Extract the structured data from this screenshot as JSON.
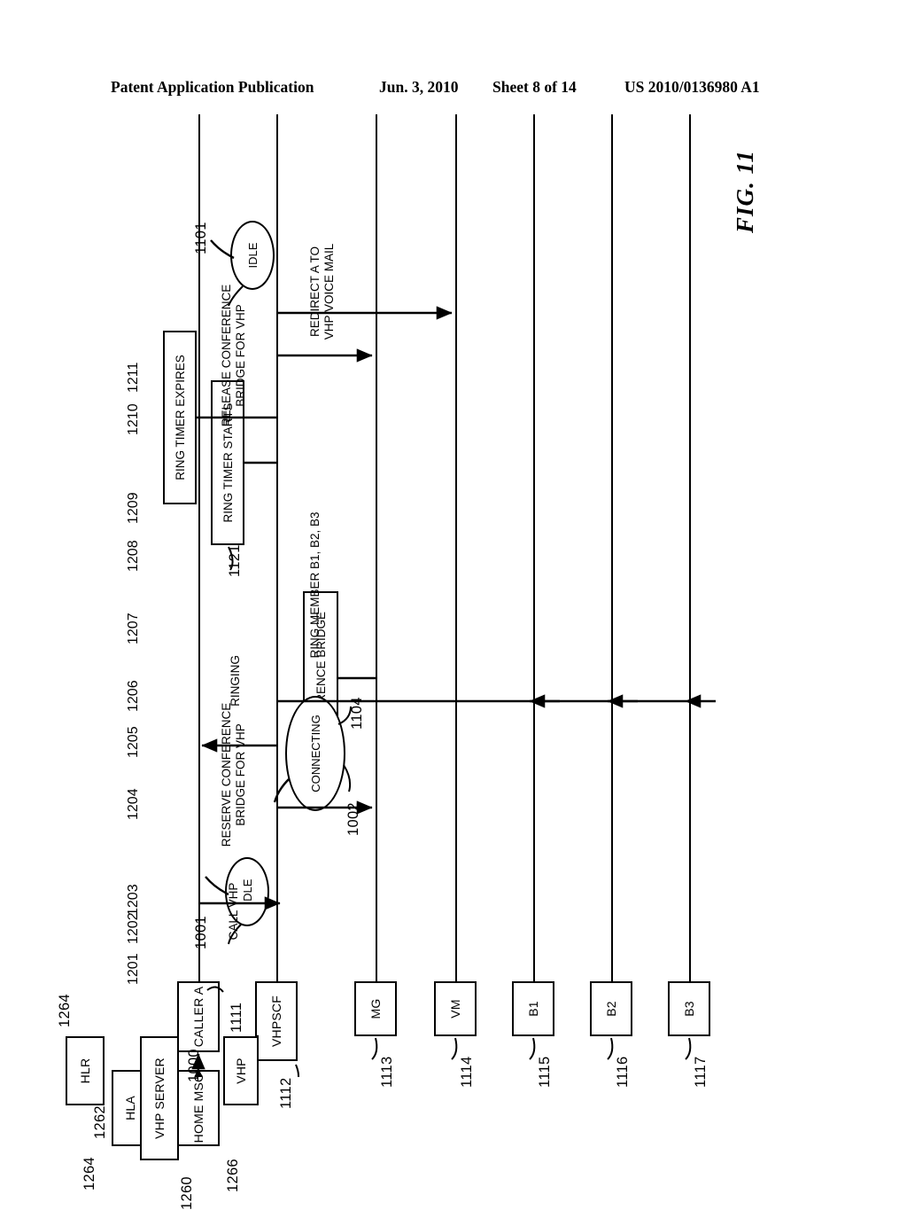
{
  "header": {
    "publication": "Patent Application Publication",
    "date": "Jun. 3, 2010",
    "sheet": "Sheet 8 of 14",
    "patent_number": "US 2010/0136980 A1"
  },
  "figure": {
    "label": "FIG. 11",
    "type": "sequence-diagram"
  },
  "nodes": [
    {
      "id": "caller_a",
      "label": "CALLER A",
      "ref": "1111"
    },
    {
      "id": "home_msc",
      "label": "HOME MSC",
      "ref": "1266"
    },
    {
      "id": "hla",
      "label": "HLA",
      "ref": "1264"
    },
    {
      "id": "vhpscf",
      "label": "VHPSCF",
      "ref": "1112"
    },
    {
      "id": "vhp",
      "label": "VHP",
      "ref": "1000"
    },
    {
      "id": "vhp_server",
      "label": "VHP SERVER",
      "ref": "1260"
    },
    {
      "id": "hlr",
      "label": "HLR",
      "ref": "1264"
    },
    {
      "id": "mg",
      "label": "MG",
      "ref": "1113"
    },
    {
      "id": "vm",
      "label": "VM",
      "ref": "1114"
    },
    {
      "id": "b1",
      "label": "B1",
      "ref": "1115"
    },
    {
      "id": "b2",
      "label": "B2",
      "ref": "1116"
    },
    {
      "id": "b3",
      "label": "B3",
      "ref": "1117"
    }
  ],
  "connector_refs": [
    {
      "id": "vhp_server_hlr_link",
      "ref": "1262"
    }
  ],
  "state_bubbles": [
    {
      "id": "idle_start",
      "label": "IDLE",
      "ref": "1001"
    },
    {
      "id": "connecting",
      "label": "CONNECTING",
      "ref": "1002"
    },
    {
      "id": "idle_end",
      "label": "IDLE",
      "ref": "1101"
    }
  ],
  "event_boxes": [
    {
      "id": "conference_bridge",
      "label": "CONFERENCE BRIDGE",
      "ref": "1104"
    },
    {
      "id": "ring_timer_starts",
      "label": "RING TIMER STARTS",
      "ref": "1121"
    },
    {
      "id": "ring_timer_expires",
      "label": "RING TIMER EXPIRES",
      "ref": ""
    }
  ],
  "messages": [
    {
      "step": "1201",
      "label": ""
    },
    {
      "step": "1202",
      "label": ""
    },
    {
      "step": "1203",
      "label": "CALL VHP"
    },
    {
      "step": "1204",
      "label": "RESERVE CONFERENCE BRIDGE FOR VHP",
      "line1": "RESERVE CONFERENCE",
      "line2": "BRIDGE FOR VHP"
    },
    {
      "step": "1205",
      "label": "RINGING"
    },
    {
      "step": "1206",
      "label": "RING MEMBER B1, B2, B3"
    },
    {
      "step": "1207",
      "label": ""
    },
    {
      "step": "1208",
      "label": ""
    },
    {
      "step": "1209",
      "label": "RELEASE CONFERENCE BRIDGE FOR VHP",
      "line1": "RELEASE CONFERENCE",
      "line2": "BRIDGE FOR VHP"
    },
    {
      "step": "1210",
      "label": "REDIRECT A TO VHP VOICE MAIL",
      "line1": "REDIRECT A TO",
      "line2": "VHP VOICE MAIL"
    },
    {
      "step": "1211",
      "label": ""
    }
  ],
  "step_numbers": [
    "1201",
    "1202",
    "1203",
    "1204",
    "1205",
    "1206",
    "1207",
    "1208",
    "1209",
    "1210",
    "1211"
  ],
  "colors": {
    "ink": "#000000",
    "paper": "#ffffff"
  }
}
